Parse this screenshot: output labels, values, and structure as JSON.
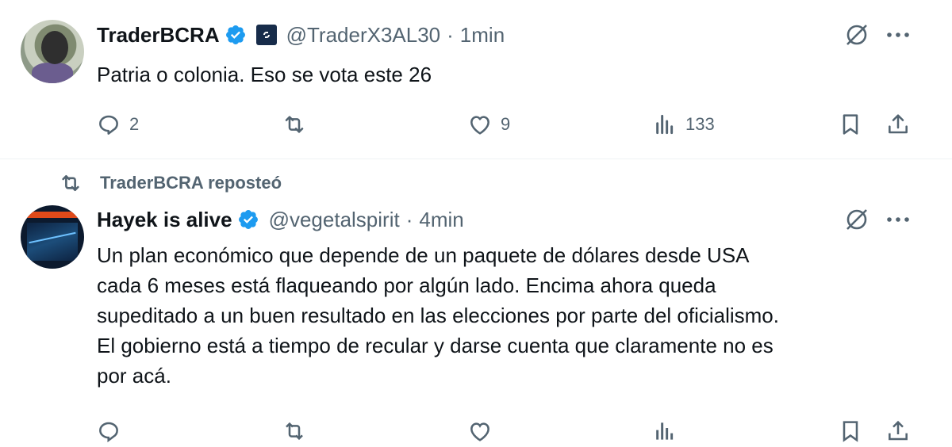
{
  "tweets": [
    {
      "author_name": "TraderBCRA",
      "handle": "@TraderX3AL30",
      "separator": "·",
      "time": "1min",
      "text": "Patria o colonia. Eso se vota este 26",
      "replies": "2",
      "reposts": "",
      "likes": "9",
      "views": "133"
    },
    {
      "repost_label": "TraderBCRA reposteó",
      "author_name": "Hayek is alive",
      "handle": "@vegetalspirit",
      "separator": "·",
      "time": "4min",
      "text_lines": [
        "Un plan económico que depende de un paquete de dólares desde USA",
        "cada 6 meses está flaqueando por algún lado. Encima ahora queda",
        "supeditado a un buen resultado en las elecciones por parte del oficialismo.",
        "El gobierno está a tiempo de recular y darse cuenta que claramente no es",
        "por acá."
      ]
    }
  ],
  "colors": {
    "verified": "#1d9bf0",
    "secondary_text": "#536471",
    "primary_text": "#0f1419",
    "affiliate_badge": "#172c4a"
  },
  "icons": [
    "verified-badge-icon",
    "affiliate-badge-icon",
    "grok-icon",
    "more-icon",
    "reply-icon",
    "repost-icon",
    "like-icon",
    "views-icon",
    "bookmark-icon",
    "share-icon"
  ]
}
